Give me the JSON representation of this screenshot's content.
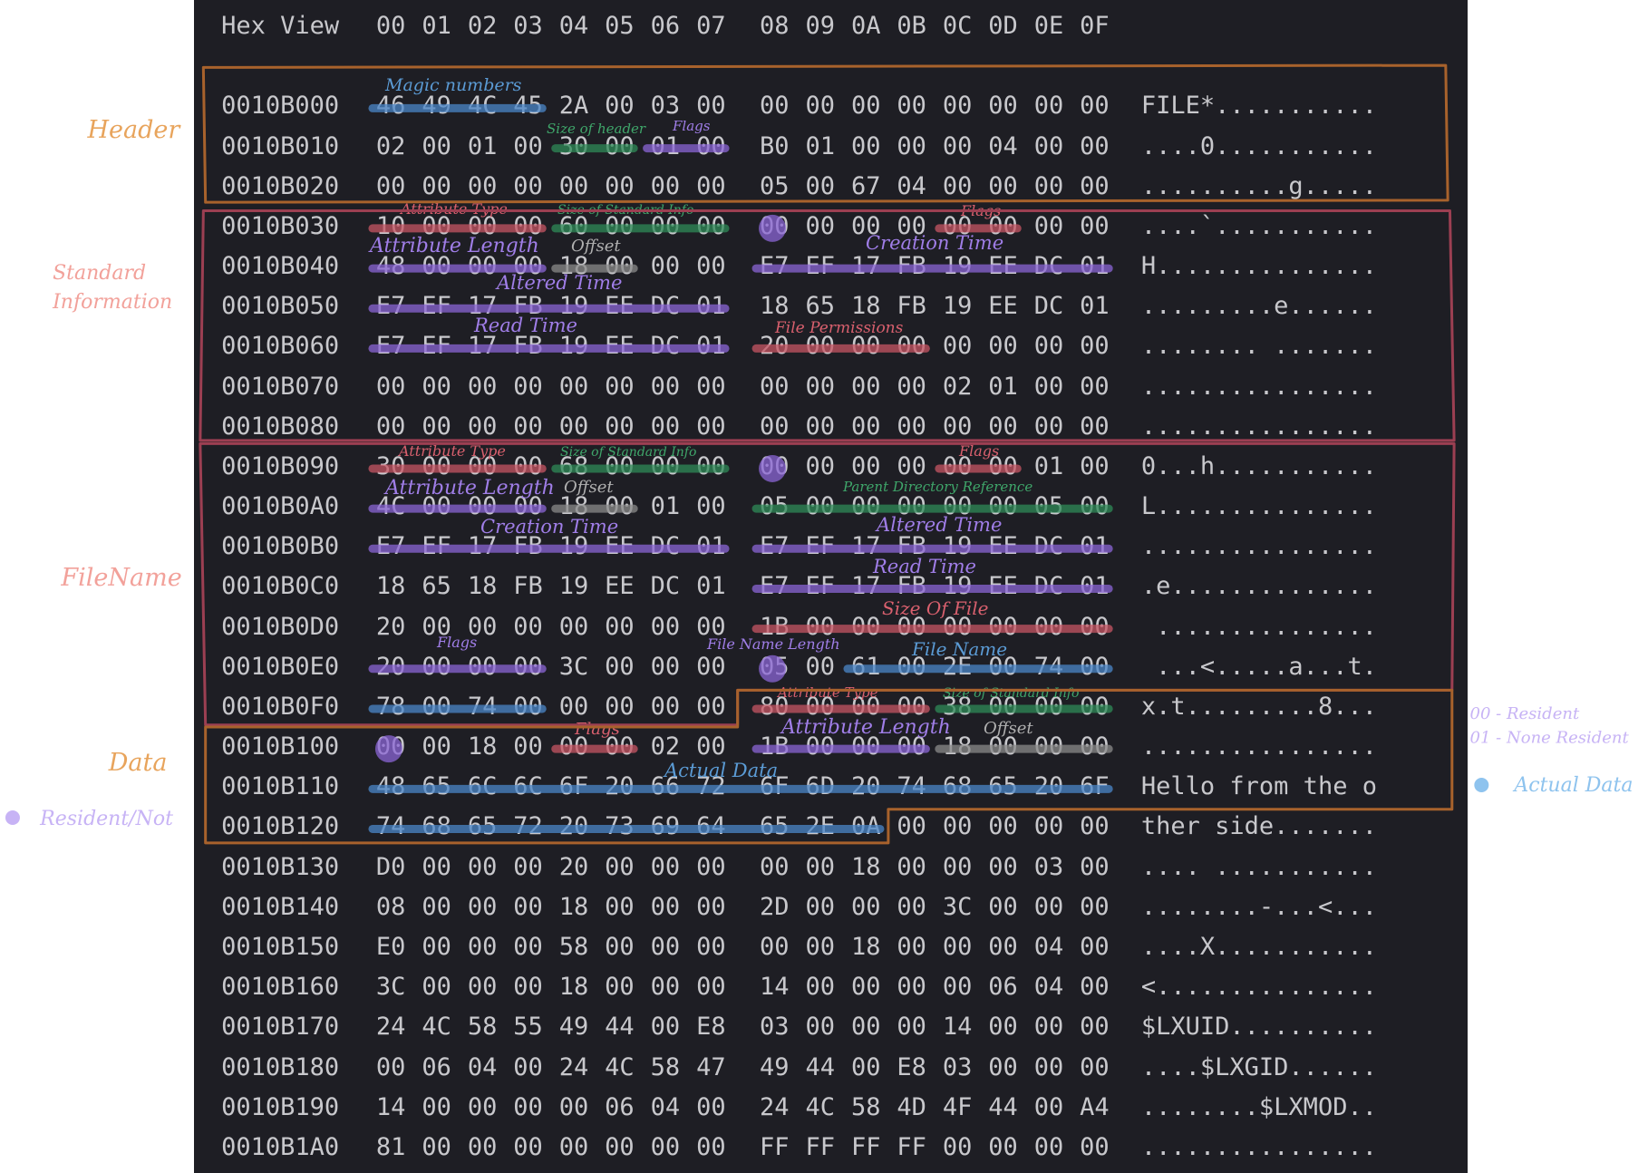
{
  "header_row": {
    "title": "Hex View",
    "cols_a": [
      "00",
      "01",
      "02",
      "03",
      "04",
      "05",
      "06",
      "07"
    ],
    "cols_b": [
      "08",
      "09",
      "0A",
      "0B",
      "0C",
      "0D",
      "0E",
      "0F"
    ]
  },
  "rows": [
    {
      "addr": "0010B000",
      "a": [
        "46",
        "49",
        "4C",
        "45",
        "2A",
        "00",
        "03",
        "00"
      ],
      "b": [
        "00",
        "00",
        "00",
        "00",
        "00",
        "00",
        "00",
        "00"
      ],
      "ascii": "FILE*..........."
    },
    {
      "addr": "0010B010",
      "a": [
        "02",
        "00",
        "01",
        "00",
        "30",
        "00",
        "01",
        "00"
      ],
      "b": [
        "B0",
        "01",
        "00",
        "00",
        "00",
        "04",
        "00",
        "00"
      ],
      "ascii": "....0..........."
    },
    {
      "addr": "0010B020",
      "a": [
        "00",
        "00",
        "00",
        "00",
        "00",
        "00",
        "00",
        "00"
      ],
      "b": [
        "05",
        "00",
        "67",
        "04",
        "00",
        "00",
        "00",
        "00"
      ],
      "ascii": "..........g....."
    },
    {
      "addr": "0010B030",
      "a": [
        "10",
        "00",
        "00",
        "00",
        "60",
        "00",
        "00",
        "00"
      ],
      "b": [
        "00",
        "00",
        "00",
        "00",
        "00",
        "00",
        "00",
        "00"
      ],
      "ascii": "....`..........."
    },
    {
      "addr": "0010B040",
      "a": [
        "48",
        "00",
        "00",
        "00",
        "18",
        "00",
        "00",
        "00"
      ],
      "b": [
        "E7",
        "EF",
        "17",
        "FB",
        "19",
        "EE",
        "DC",
        "01"
      ],
      "ascii": "H..............."
    },
    {
      "addr": "0010B050",
      "a": [
        "E7",
        "EF",
        "17",
        "FB",
        "19",
        "EE",
        "DC",
        "01"
      ],
      "b": [
        "18",
        "65",
        "18",
        "FB",
        "19",
        "EE",
        "DC",
        "01"
      ],
      "ascii": ".........e......"
    },
    {
      "addr": "0010B060",
      "a": [
        "E7",
        "EF",
        "17",
        "FB",
        "19",
        "EE",
        "DC",
        "01"
      ],
      "b": [
        "20",
        "00",
        "00",
        "00",
        "00",
        "00",
        "00",
        "00"
      ],
      "ascii": "........ ......."
    },
    {
      "addr": "0010B070",
      "a": [
        "00",
        "00",
        "00",
        "00",
        "00",
        "00",
        "00",
        "00"
      ],
      "b": [
        "00",
        "00",
        "00",
        "00",
        "02",
        "01",
        "00",
        "00"
      ],
      "ascii": "................"
    },
    {
      "addr": "0010B080",
      "a": [
        "00",
        "00",
        "00",
        "00",
        "00",
        "00",
        "00",
        "00"
      ],
      "b": [
        "00",
        "00",
        "00",
        "00",
        "00",
        "00",
        "00",
        "00"
      ],
      "ascii": "................"
    },
    {
      "addr": "0010B090",
      "a": [
        "30",
        "00",
        "00",
        "00",
        "68",
        "00",
        "00",
        "00"
      ],
      "b": [
        "00",
        "00",
        "00",
        "00",
        "00",
        "00",
        "01",
        "00"
      ],
      "ascii": "0...h..........."
    },
    {
      "addr": "0010B0A0",
      "a": [
        "4C",
        "00",
        "00",
        "00",
        "18",
        "00",
        "01",
        "00"
      ],
      "b": [
        "05",
        "00",
        "00",
        "00",
        "00",
        "00",
        "05",
        "00"
      ],
      "ascii": "L..............."
    },
    {
      "addr": "0010B0B0",
      "a": [
        "E7",
        "EF",
        "17",
        "FB",
        "19",
        "EE",
        "DC",
        "01"
      ],
      "b": [
        "E7",
        "EF",
        "17",
        "FB",
        "19",
        "EE",
        "DC",
        "01"
      ],
      "ascii": "................"
    },
    {
      "addr": "0010B0C0",
      "a": [
        "18",
        "65",
        "18",
        "FB",
        "19",
        "EE",
        "DC",
        "01"
      ],
      "b": [
        "E7",
        "EF",
        "17",
        "FB",
        "19",
        "EE",
        "DC",
        "01"
      ],
      "ascii": ".e.............."
    },
    {
      "addr": "0010B0D0",
      "a": [
        "20",
        "00",
        "00",
        "00",
        "00",
        "00",
        "00",
        "00"
      ],
      "b": [
        "1B",
        "00",
        "00",
        "00",
        "00",
        "00",
        "00",
        "00"
      ],
      "ascii": " ..............."
    },
    {
      "addr": "0010B0E0",
      "a": [
        "20",
        "00",
        "00",
        "00",
        "3C",
        "00",
        "00",
        "00"
      ],
      "b": [
        "05",
        "00",
        "61",
        "00",
        "2E",
        "00",
        "74",
        "00"
      ],
      "ascii": " ...<.....a...t."
    },
    {
      "addr": "0010B0F0",
      "a": [
        "78",
        "00",
        "74",
        "00",
        "00",
        "00",
        "00",
        "00"
      ],
      "b": [
        "80",
        "00",
        "00",
        "00",
        "38",
        "00",
        "00",
        "00"
      ],
      "ascii": "x.t.........8..."
    },
    {
      "addr": "0010B100",
      "a": [
        "00",
        "00",
        "18",
        "00",
        "00",
        "00",
        "02",
        "00"
      ],
      "b": [
        "1B",
        "00",
        "00",
        "00",
        "18",
        "00",
        "00",
        "00"
      ],
      "ascii": "................"
    },
    {
      "addr": "0010B110",
      "a": [
        "48",
        "65",
        "6C",
        "6C",
        "6F",
        "20",
        "66",
        "72"
      ],
      "b": [
        "6F",
        "6D",
        "20",
        "74",
        "68",
        "65",
        "20",
        "6F"
      ],
      "ascii": "Hello from the o"
    },
    {
      "addr": "0010B120",
      "a": [
        "74",
        "68",
        "65",
        "72",
        "20",
        "73",
        "69",
        "64"
      ],
      "b": [
        "65",
        "2E",
        "0A",
        "00",
        "00",
        "00",
        "00",
        "00"
      ],
      "ascii": "ther side......."
    },
    {
      "addr": "0010B130",
      "a": [
        "D0",
        "00",
        "00",
        "00",
        "20",
        "00",
        "00",
        "00"
      ],
      "b": [
        "00",
        "00",
        "18",
        "00",
        "00",
        "00",
        "03",
        "00"
      ],
      "ascii": ".... ..........."
    },
    {
      "addr": "0010B140",
      "a": [
        "08",
        "00",
        "00",
        "00",
        "18",
        "00",
        "00",
        "00"
      ],
      "b": [
        "2D",
        "00",
        "00",
        "00",
        "3C",
        "00",
        "00",
        "00"
      ],
      "ascii": "........-...<..."
    },
    {
      "addr": "0010B150",
      "a": [
        "E0",
        "00",
        "00",
        "00",
        "58",
        "00",
        "00",
        "00"
      ],
      "b": [
        "00",
        "00",
        "18",
        "00",
        "00",
        "00",
        "04",
        "00"
      ],
      "ascii": "....X..........."
    },
    {
      "addr": "0010B160",
      "a": [
        "3C",
        "00",
        "00",
        "00",
        "18",
        "00",
        "00",
        "00"
      ],
      "b": [
        "14",
        "00",
        "00",
        "00",
        "00",
        "06",
        "04",
        "00"
      ],
      "ascii": "<..............."
    },
    {
      "addr": "0010B170",
      "a": [
        "24",
        "4C",
        "58",
        "55",
        "49",
        "44",
        "00",
        "E8"
      ],
      "b": [
        "03",
        "00",
        "00",
        "00",
        "14",
        "00",
        "00",
        "00"
      ],
      "ascii": "$LXUID.........."
    },
    {
      "addr": "0010B180",
      "a": [
        "00",
        "06",
        "04",
        "00",
        "24",
        "4C",
        "58",
        "47"
      ],
      "b": [
        "49",
        "44",
        "00",
        "E8",
        "03",
        "00",
        "00",
        "00"
      ],
      "ascii": "....$LXGID......"
    },
    {
      "addr": "0010B190",
      "a": [
        "14",
        "00",
        "00",
        "00",
        "00",
        "06",
        "04",
        "00"
      ],
      "b": [
        "24",
        "4C",
        "58",
        "4D",
        "4F",
        "44",
        "00",
        "A4"
      ],
      "ascii": "........$LXMOD.."
    },
    {
      "addr": "0010B1A0",
      "a": [
        "81",
        "00",
        "00",
        "00",
        "00",
        "00",
        "00",
        "00"
      ],
      "b": [
        "FF",
        "FF",
        "FF",
        "FF",
        "00",
        "00",
        "00",
        "00"
      ],
      "ascii": "................"
    }
  ],
  "sections": [
    {
      "name": "Header",
      "color": "#e8a45c"
    },
    {
      "name": "Standard\nInformation",
      "color": "#f2a19a"
    },
    {
      "name": "FileName",
      "color": "#f2a19a"
    },
    {
      "name": "Data",
      "color": "#e8a45c"
    }
  ],
  "annotations": [
    {
      "text": "Magic numbers",
      "color": "#5b9bd5"
    },
    {
      "text": "Size of header",
      "color": "#3fa66a"
    },
    {
      "text": "Flags",
      "color": "#a07ee8"
    },
    {
      "text": "Attribute Type",
      "color": "#d9606e"
    },
    {
      "text": "Size of Standard Info",
      "color": "#3fa66a"
    },
    {
      "text": "Flags",
      "color": "#d9606e"
    },
    {
      "text": "Attribute Length",
      "color": "#a07ee8"
    },
    {
      "text": "Offset",
      "color": "#b0b0b0"
    },
    {
      "text": "Creation Time",
      "color": "#a07ee8"
    },
    {
      "text": "Altered Time",
      "color": "#a07ee8"
    },
    {
      "text": "Read Time",
      "color": "#a07ee8"
    },
    {
      "text": "File Permissions",
      "color": "#d9606e"
    },
    {
      "text": "Attribute Type",
      "color": "#d9606e"
    },
    {
      "text": "Size of Standard Info",
      "color": "#3fa66a"
    },
    {
      "text": "Flags",
      "color": "#d9606e"
    },
    {
      "text": "Attribute Length",
      "color": "#a07ee8"
    },
    {
      "text": "Offset",
      "color": "#b0b0b0"
    },
    {
      "text": "Parent Directory Reference",
      "color": "#3fa66a"
    },
    {
      "text": "Creation Time",
      "color": "#a07ee8"
    },
    {
      "text": "Altered Time",
      "color": "#a07ee8"
    },
    {
      "text": "Read Time",
      "color": "#a07ee8"
    },
    {
      "text": "Size Of File",
      "color": "#d9606e"
    },
    {
      "text": "Flags",
      "color": "#a07ee8"
    },
    {
      "text": "File Name Length",
      "color": "#a07ee8"
    },
    {
      "text": "File Name",
      "color": "#5b9bd5"
    },
    {
      "text": "Attribute Type",
      "color": "#d9606e"
    },
    {
      "text": "Size of Standard Info",
      "color": "#3fa66a"
    },
    {
      "text": "Attribute Length",
      "color": "#a07ee8"
    },
    {
      "text": "Offset",
      "color": "#b0b0b0"
    },
    {
      "text": "Flags",
      "color": "#d9606e"
    },
    {
      "text": "Actual Data",
      "color": "#5b9bd5"
    }
  ],
  "legend": {
    "resident_not": {
      "text": "Resident/Not",
      "color": "#c7b3f5"
    },
    "resident_key": {
      "text": "00 - Resident\n01 - None Resident",
      "color": "#c7b3f5"
    },
    "actual_data": {
      "text": "Actual Data",
      "color": "#8ec3ee"
    }
  }
}
